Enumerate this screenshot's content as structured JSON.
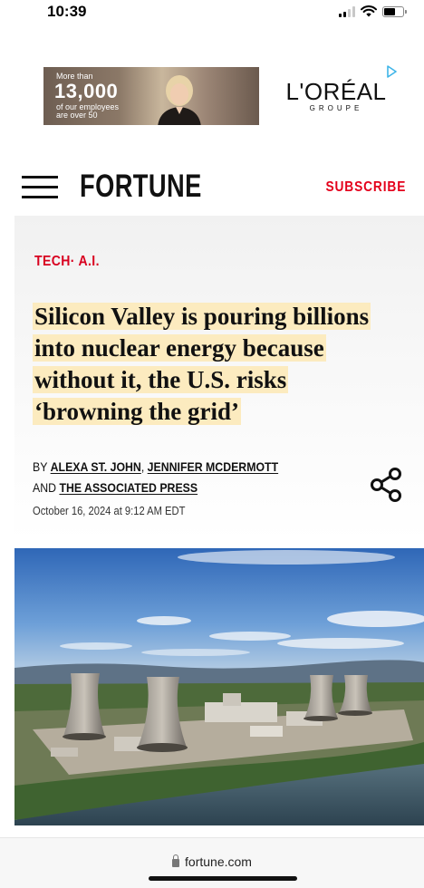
{
  "status_bar": {
    "time": "10:39",
    "icons": [
      "signal-icon",
      "wifi-icon",
      "battery-icon"
    ]
  },
  "ad": {
    "small_top": "More than",
    "number": "13,000",
    "small_bottom_1": "of our employees",
    "small_bottom_2": "are over 50",
    "brand": "L'ORÉAL",
    "brand_sub": "GROUPE",
    "adchoices_icon": "adchoices-icon"
  },
  "header": {
    "menu_icon": "hamburger-menu-icon",
    "logo": "FORTUNE",
    "subscribe_label": "SUBSCRIBE",
    "accent_color": "#e4001b"
  },
  "article": {
    "category": "TECH· A.I.",
    "headline_lines": [
      "Silicon Valley is pouring billions",
      "into nuclear energy because",
      "without it, the U.S. risks",
      "‘browning the grid’"
    ],
    "highlight_color": "#fcebbf",
    "byline_prefix": "BY",
    "authors": [
      "ALEXA ST. JOHN",
      "JENNIFER MCDERMOTT"
    ],
    "byline_and": "AND",
    "organization": "THE ASSOCIATED PRESS",
    "date": "October 16, 2024 at 9:12 AM EDT",
    "share_icon": "share-icon",
    "hero_image": "nuclear-power-plant-cooling-towers-photo"
  },
  "browser": {
    "url": "fortune.com",
    "lock_icon": "lock-icon"
  }
}
